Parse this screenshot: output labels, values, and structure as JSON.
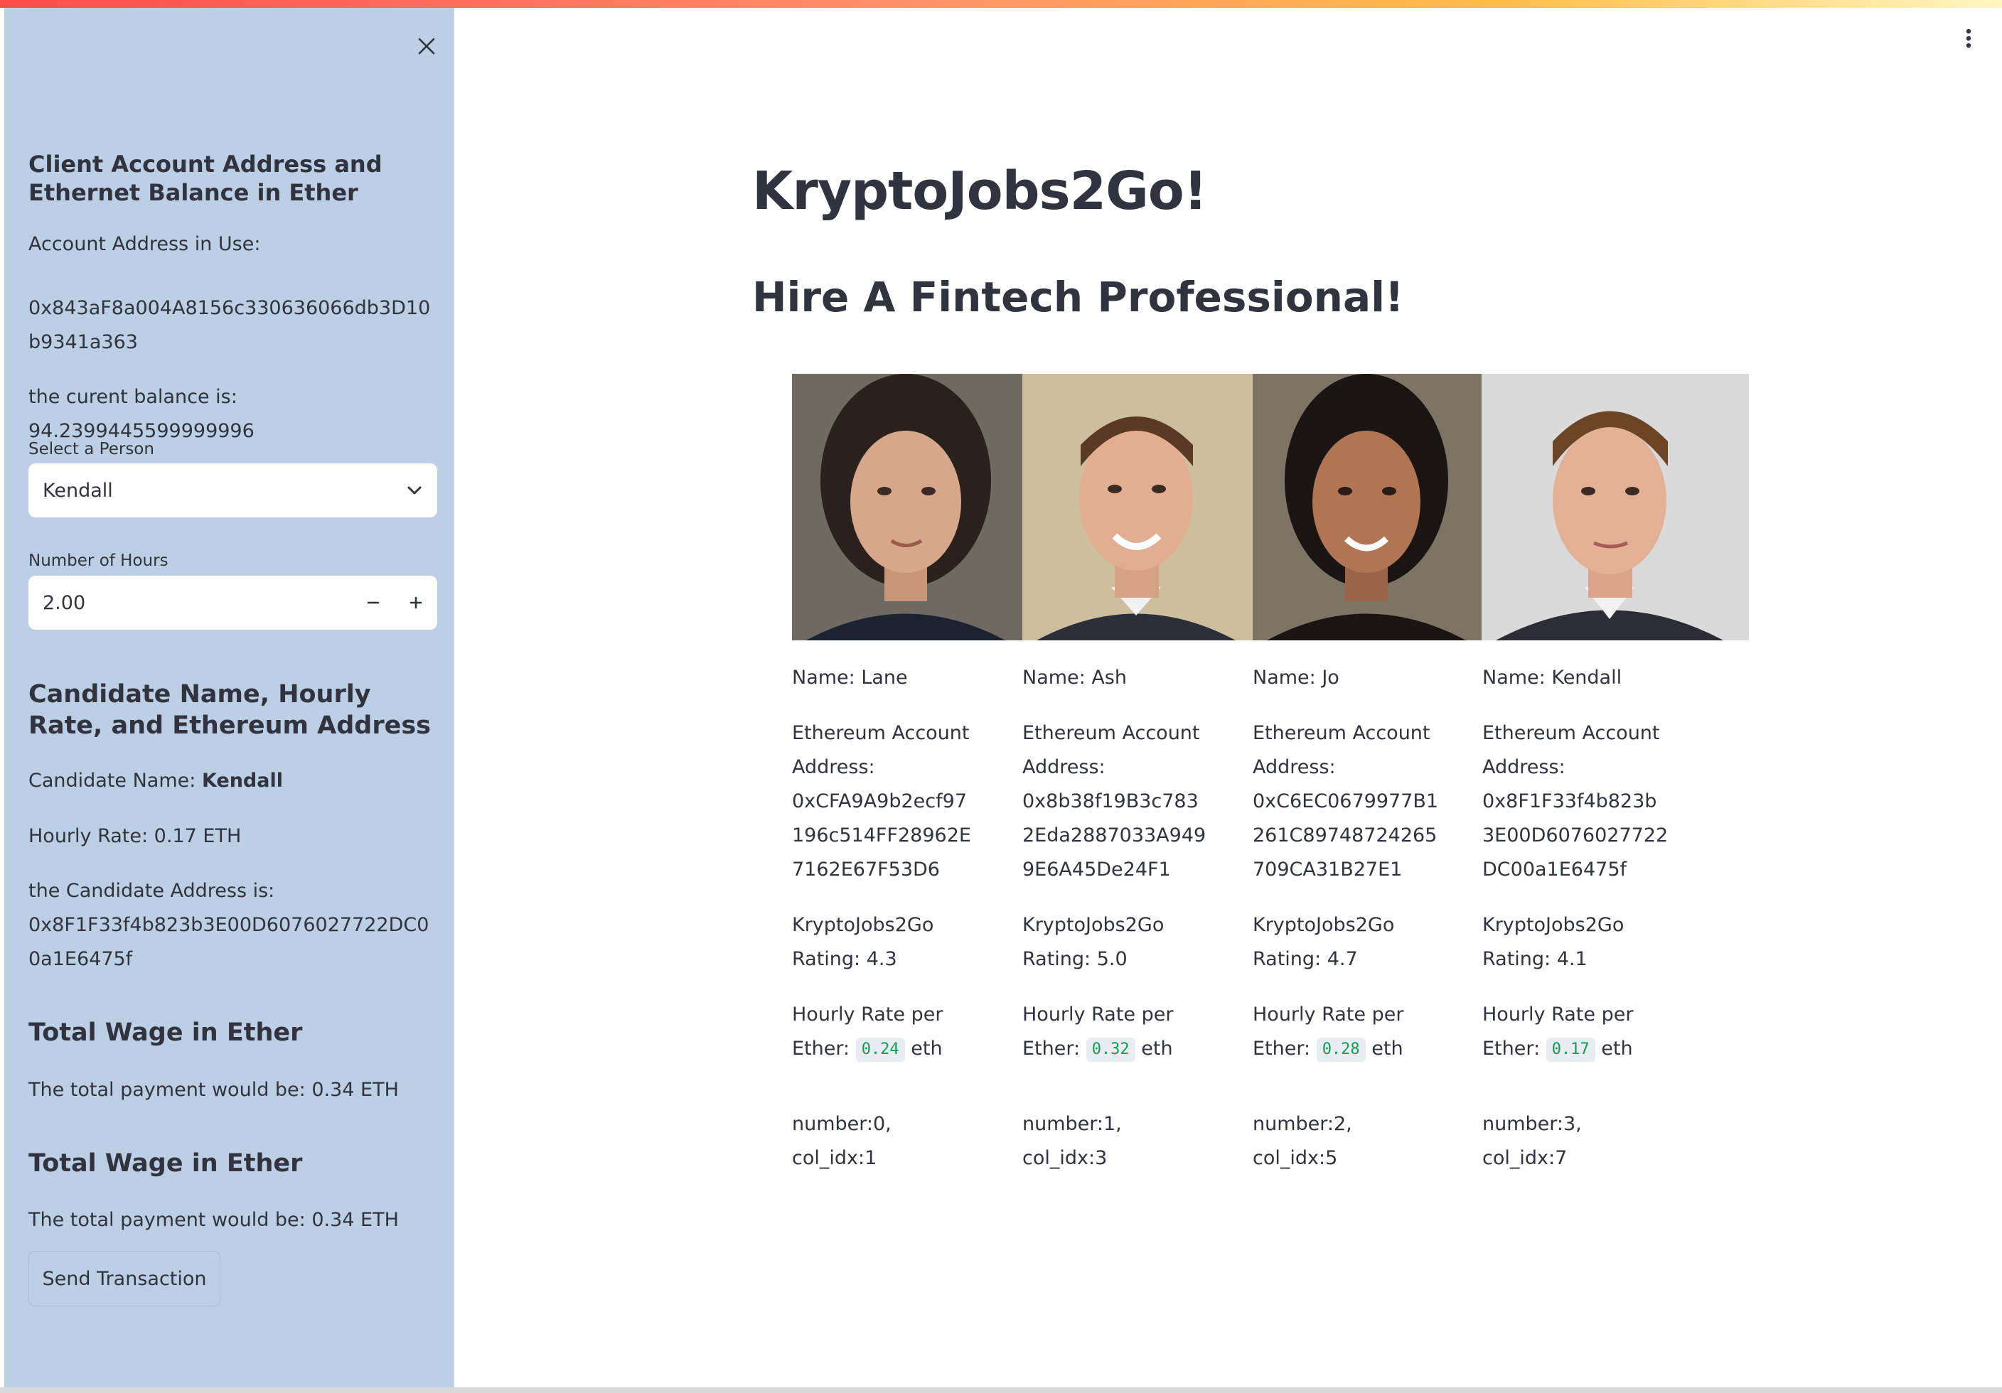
{
  "sidebar": {
    "heading_account": "Client Account Address and Ethernet Balance in Ether",
    "account_label": "Account Address in Use:",
    "account_address": "0x843aF8a004A8156c330636066db3D10b9341a363",
    "balance_text": "the curent balance is: 94.2399445599999996",
    "select_label": "Select a Person",
    "select_value": "Kendall",
    "hours_label": "Number of Hours",
    "hours_value": "2.00",
    "heading_candidate": "Candidate Name, Hourly Rate, and Ethereum Address",
    "candidate_name_prefix": "Candidate Name: ",
    "candidate_name": "Kendall",
    "hourly_rate": "Hourly Rate: 0.17 ETH",
    "candidate_address_label": "the Candidate Address is:",
    "candidate_address": "0x8F1F33f4b823b3E00D6076027722DC00a1E6475f",
    "wage_heading_1": "Total Wage in Ether",
    "wage_text_1": "The total payment would be: 0.34 ETH",
    "wage_heading_2": "Total Wage in Ether",
    "wage_text_2": "The total payment would be: 0.34 ETH",
    "send_button": "Send Transaction"
  },
  "main": {
    "title": "KryptoJobs2Go!",
    "subtitle": "Hire A Fintech Professional!",
    "candidates": [
      {
        "name": "Name: Lane",
        "account_label": "Ethereum Account Address:",
        "address": "0xCFA9A9b2ecf97196c514FF28962E7162E67F53D6",
        "rating": "KryptoJobs2Go Rating: 4.3",
        "rate_prefix": "Hourly Rate per Ether: ",
        "rate": "0.24",
        "rate_suffix": " eth",
        "number": "number:0,",
        "col_idx": "col_idx:1"
      },
      {
        "name": "Name: Ash",
        "account_label": "Ethereum Account Address:",
        "address": "0x8b38f19B3c7832Eda2887033A9499E6A45De24F1",
        "rating": "KryptoJobs2Go Rating: 5.0",
        "rate_prefix": "Hourly Rate per Ether: ",
        "rate": "0.32",
        "rate_suffix": " eth",
        "number": "number:1,",
        "col_idx": "col_idx:3"
      },
      {
        "name": "Name: Jo",
        "account_label": "Ethereum Account Address:",
        "address": "0xC6EC0679977B1261C89748724265709CA31B27E1",
        "rating": "KryptoJobs2Go Rating: 4.7",
        "rate_prefix": "Hourly Rate per Ether: ",
        "rate": "0.28",
        "rate_suffix": " eth",
        "number": "number:2,",
        "col_idx": "col_idx:5"
      },
      {
        "name": "Name: Kendall",
        "account_label": "Ethereum Account Address:",
        "address": "0x8F1F33f4b823b3E00D6076027722DC00a1E6475f",
        "rating": "KryptoJobs2Go Rating: 4.1",
        "rate_prefix": "Hourly Rate per Ether: ",
        "rate": "0.17",
        "rate_suffix": " eth",
        "number": "number:3,",
        "col_idx": "col_idx:7"
      }
    ]
  },
  "icons": {
    "close": "close-icon",
    "dropdown": "chevron-down-icon",
    "minus": "minus-icon",
    "plus": "plus-icon",
    "menu": "kebab-menu-icon"
  },
  "colors": {
    "sidebar_bg": "#bccfe5",
    "text": "#31333f",
    "code_green": "#0f9d58"
  }
}
